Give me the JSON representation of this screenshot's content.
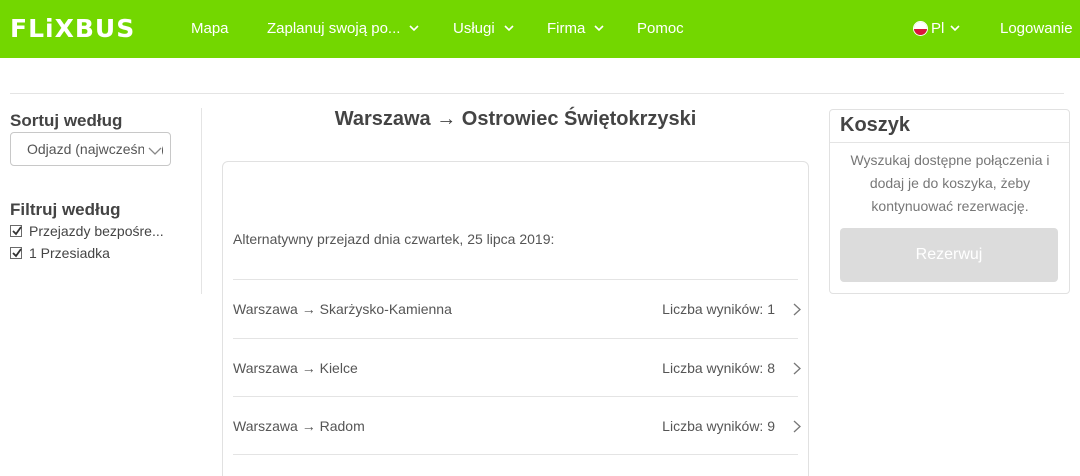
{
  "header": {
    "logo": "FLiXBUS",
    "nav": [
      {
        "label": "Mapa"
      },
      {
        "label": "Zaplanuj swoją po..."
      },
      {
        "label": "Usługi"
      },
      {
        "label": "Firma"
      },
      {
        "label": "Pomoc"
      }
    ],
    "language": "Pl",
    "login": "Logowanie"
  },
  "sidebar": {
    "sort_heading": "Sortuj według",
    "sort_selected": "Odjazd (najwcześniej)",
    "filter_heading": "Filtruj według",
    "filters": [
      {
        "label": "Przejazdy bezpośre...",
        "checked": true
      },
      {
        "label": "1 Przesiadka",
        "checked": true
      }
    ]
  },
  "main": {
    "route_title": "Warszawa → Ostrowiec Świętokrzyski",
    "alternative_text": "Alternatywny przejazd dnia czwartek, 25 lipca 2019:",
    "results": [
      {
        "route": "Warszawa → Skarżysko-Kamienna",
        "count": "Liczba wyników: 1"
      },
      {
        "route": "Warszawa → Kielce",
        "count": "Liczba wyników: 8"
      },
      {
        "route": "Warszawa → Radom",
        "count": "Liczba wyników: 9"
      }
    ]
  },
  "cart": {
    "title": "Koszyk",
    "description": "Wyszukaj dostępne połączenia i dodaj je do koszyka, żeby kontynuować rezerwację.",
    "book_label": "Rezerwuj"
  },
  "colors": {
    "brand": "#73d700",
    "button_disabled": "#dcdcdc"
  }
}
